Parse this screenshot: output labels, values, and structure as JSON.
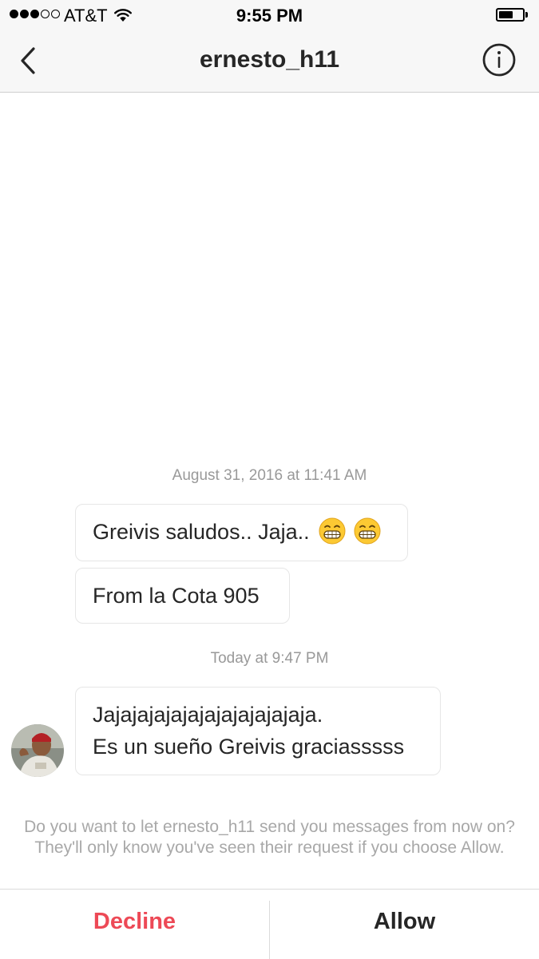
{
  "status_bar": {
    "carrier": "AT&T",
    "time": "9:55 PM",
    "signal_bars_filled": 3,
    "signal_bars_total": 5,
    "battery_level": 0.65
  },
  "nav": {
    "title": "ernesto_h11",
    "back_icon": "chevron-left-icon",
    "info_icon": "info-icon"
  },
  "conversation": {
    "groups": [
      {
        "timestamp": "August 31, 2016 at 11:41 AM",
        "messages": [
          {
            "text": "Greivis saludos.. Jaja..",
            "emoji": "grinning-face-emoji"
          },
          {
            "text": "From la Cota 905"
          }
        ]
      },
      {
        "timestamp": "Today at 9:47 PM",
        "messages": [
          {
            "line1": "Jajajajajajajajajajajajaja.",
            "line2": "Es un sueño Greivis graciasssss"
          }
        ]
      }
    ]
  },
  "request": {
    "prompt": "Do you want to let ernesto_h11 send you messages from now on? They'll only know you've seen their request if you choose Allow.",
    "decline_label": "Decline",
    "allow_label": "Allow"
  },
  "colors": {
    "decline": "#ed4956",
    "text": "#262626",
    "muted": "#999999",
    "bar_background": "#f7f7f7"
  }
}
